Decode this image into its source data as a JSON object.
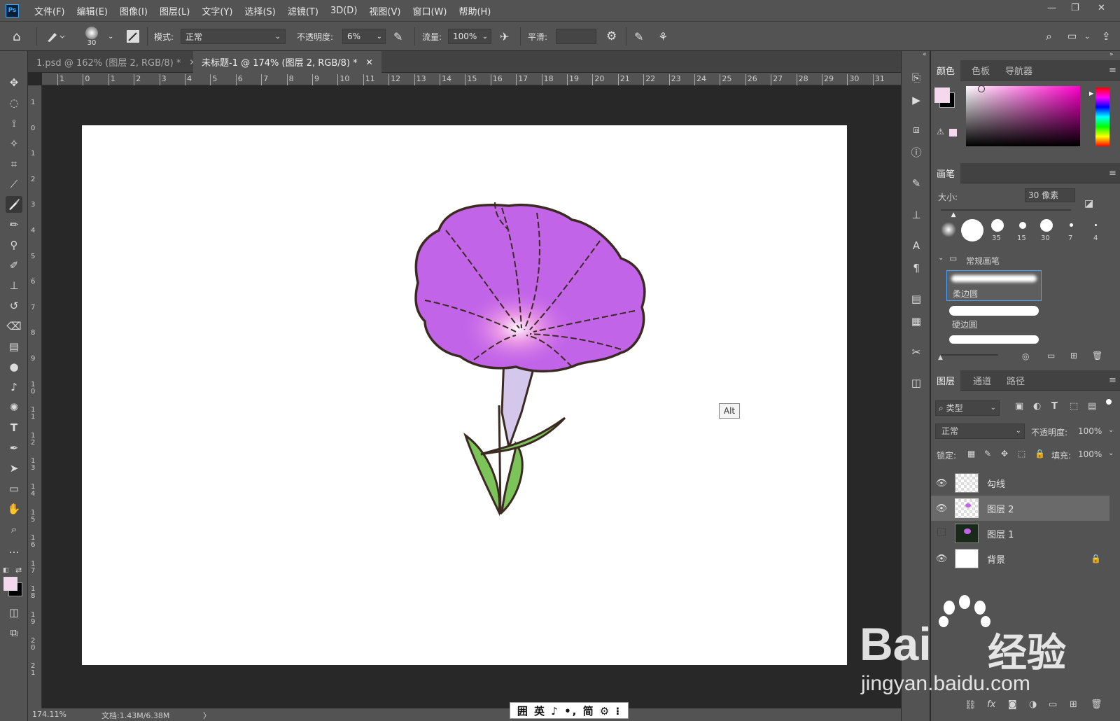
{
  "menubar": {
    "logo": "Ps",
    "items": [
      "文件(F)",
      "编辑(E)",
      "图像(I)",
      "图层(L)",
      "文字(Y)",
      "选择(S)",
      "滤镜(T)",
      "3D(D)",
      "视图(V)",
      "窗口(W)",
      "帮助(H)"
    ],
    "window_controls": [
      "—",
      "❐",
      "✕"
    ]
  },
  "options": {
    "brush_size": "30",
    "mode_label": "模式:",
    "mode_value": "正常",
    "opacity_label": "不透明度:",
    "opacity_value": "6%",
    "flow_label": "流量:",
    "flow_value": "100%",
    "smoothing_label": "平滑:",
    "smoothing_value": ""
  },
  "tabs": [
    {
      "label": "1.psd @ 162% (图层 2, RGB/8) *",
      "active": false
    },
    {
      "label": "未标题-1 @ 174% (图层 2, RGB/8) *",
      "active": true
    }
  ],
  "ruler_top": [
    "1",
    "0",
    "1",
    "2",
    "3",
    "4",
    "5",
    "6",
    "7",
    "8",
    "9",
    "10",
    "11",
    "12",
    "13",
    "14",
    "15",
    "16",
    "17",
    "18",
    "19",
    "20",
    "21",
    "22",
    "23",
    "24",
    "25",
    "26",
    "27",
    "28",
    "29",
    "30",
    "31"
  ],
  "ruler_left": [
    "1",
    "0",
    "1",
    "2",
    "3",
    "4",
    "5",
    "6",
    "7",
    "8",
    "9",
    "1 0",
    "1 1",
    "1 2",
    "1 3",
    "1 4",
    "1 5",
    "1 6",
    "1 7",
    "1 8",
    "1 9",
    "2 0",
    "2 1"
  ],
  "canvas": {
    "alt_hint": "Alt"
  },
  "status": {
    "zoom": "174.11%",
    "doc": "文档:1.43M/6.38M",
    "arrow": "〉"
  },
  "ime": {
    "text": "囲 英 ♪ •, 简 ⚙ ⁝"
  },
  "color_panel": {
    "tabs": [
      "颜色",
      "色板",
      "导航器"
    ],
    "fg_color": "#f6d8ee",
    "bg_color": "#000000",
    "hue": "#ff00cc"
  },
  "brush_panel": {
    "title": "画笔",
    "size_label": "大小:",
    "size_value": "30 像素",
    "size_fraction": 0.1,
    "presets": [
      "",
      "",
      "35",
      "15",
      "30",
      "7",
      "4"
    ],
    "group_label": "常规画笔",
    "strokes": [
      "柔边圆",
      "硬边圆",
      ""
    ]
  },
  "layers_panel": {
    "tabs": [
      "图层",
      "通道",
      "路径"
    ],
    "filter_label": "类型",
    "blend_mode": "正常",
    "opacity_label": "不透明度:",
    "opacity_value": "100%",
    "lock_label": "锁定:",
    "fill_label": "填充:",
    "fill_value": "100%",
    "layers": [
      {
        "name": "勾线",
        "visible": true,
        "selected": false,
        "locked": false
      },
      {
        "name": "图层 2",
        "visible": true,
        "selected": true,
        "locked": false
      },
      {
        "name": "图层 1",
        "visible": false,
        "selected": false,
        "locked": false
      },
      {
        "name": "背景",
        "visible": true,
        "selected": false,
        "locked": true
      }
    ]
  },
  "watermark": {
    "line1": "Bai",
    "line2": "du",
    "line3": "经验",
    "url": "jingyan.baidu.com"
  }
}
